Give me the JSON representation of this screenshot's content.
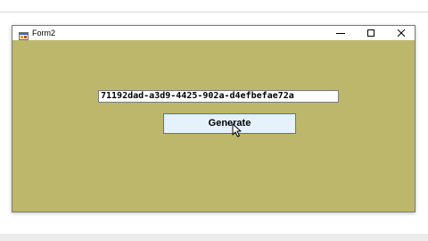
{
  "window": {
    "title": "Form2",
    "background_color": "#bdb76b",
    "icons": {
      "app": "app-icon",
      "minimize": "minimize-icon",
      "maximize": "maximize-icon",
      "close": "close-icon"
    }
  },
  "form": {
    "guid_value": "71192dad-a3d9-4425-902a-d4efbefae72a",
    "generate_label": "Generate"
  },
  "cursor": "arrow-pointer-icon"
}
